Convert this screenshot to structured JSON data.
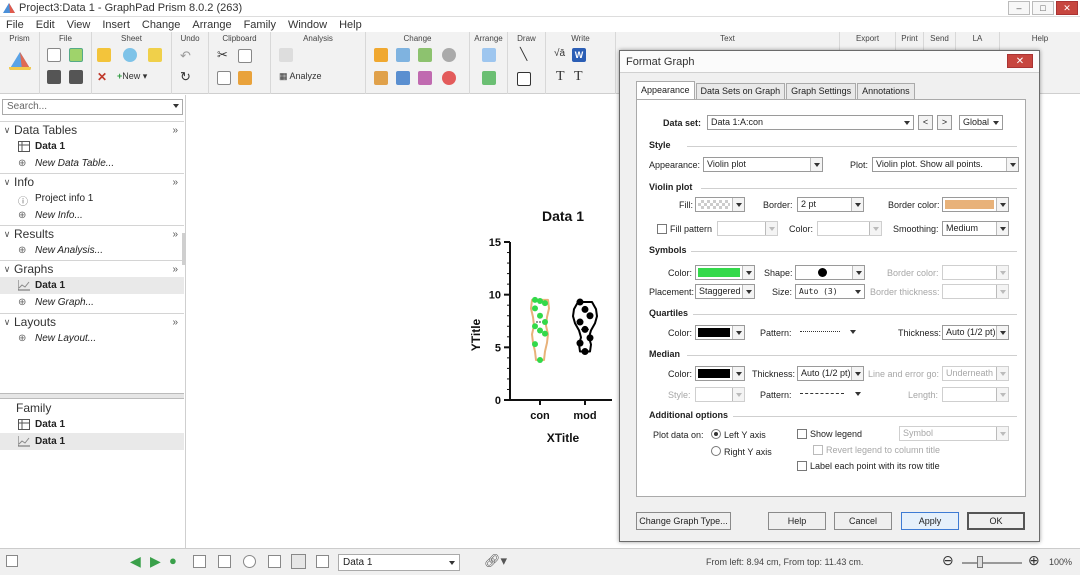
{
  "window": {
    "title": "Project3:Data 1 - GraphPad Prism 8.0.2 (263)"
  },
  "menu": [
    "File",
    "Edit",
    "View",
    "Insert",
    "Change",
    "Arrange",
    "Family",
    "Window",
    "Help"
  ],
  "ribbon": {
    "groups": [
      "Prism",
      "File",
      "Sheet",
      "Undo",
      "Clipboard",
      "Analysis",
      "Change",
      "Arrange",
      "Draw",
      "Write",
      "Text",
      "Export",
      "Print",
      "Send",
      "LA",
      "Help"
    ],
    "new_label": "New",
    "analyze_label": "Analyze"
  },
  "nav": {
    "search_placeholder": "Search...",
    "sections": [
      {
        "title": "Data Tables",
        "items": [
          {
            "label": "Data 1"
          },
          {
            "label": "New Data Table..."
          }
        ]
      },
      {
        "title": "Info",
        "items": [
          {
            "label": "Project info 1"
          },
          {
            "label": "New Info..."
          }
        ]
      },
      {
        "title": "Results",
        "items": [
          {
            "label": "New Analysis..."
          }
        ]
      },
      {
        "title": "Graphs",
        "items": [
          {
            "label": "Data 1"
          },
          {
            "label": "New Graph..."
          }
        ]
      },
      {
        "title": "Layouts",
        "items": [
          {
            "label": "New Layout..."
          }
        ]
      }
    ],
    "family": {
      "title": "Family",
      "items": [
        {
          "label": "Data 1"
        },
        {
          "label": "Data 1"
        }
      ]
    }
  },
  "graph": {
    "title": "Data 1",
    "ylabel": "YTitle",
    "xlabel": "XTitle",
    "yticks": [
      "0",
      "5",
      "10",
      "15"
    ],
    "categories": [
      "con",
      "mod"
    ]
  },
  "chart_data": {
    "type": "violin",
    "title": "Data 1",
    "xlabel": "XTitle",
    "ylabel": "YTitle",
    "ylim": [
      0,
      15
    ],
    "categories": [
      "con",
      "mod"
    ],
    "series": [
      {
        "name": "con",
        "values": [
          9.5,
          9.4,
          9.2,
          8.7,
          8.0,
          7.4,
          7.0,
          6.6,
          6.3,
          5.3,
          3.8
        ]
      },
      {
        "name": "mod",
        "values": [
          9.3,
          8.6,
          8.0,
          7.4,
          6.7,
          5.9,
          5.4,
          4.6
        ]
      }
    ]
  },
  "status": {
    "sheet": "Data 1",
    "position": "From left: 8.94 cm, From top: 11.43 cm.",
    "zoom": "100%"
  },
  "dialog": {
    "title": "Format Graph",
    "tabs": [
      "Appearance",
      "Data Sets on Graph",
      "Graph Settings",
      "Annotations"
    ],
    "dataset_label": "Data set:",
    "dataset_value": "Data 1:A:con",
    "scope": "Global",
    "sections": {
      "style": "Style",
      "violin": "Violin plot",
      "symbols": "Symbols",
      "quartiles": "Quartiles",
      "median": "Median",
      "additional": "Additional options"
    },
    "style": {
      "appearance_label": "Appearance:",
      "appearance_value": "Violin plot",
      "plot_label": "Plot:",
      "plot_value": "Violin plot. Show all points."
    },
    "violin": {
      "fill_label": "Fill:",
      "border_label": "Border:",
      "border_value": "2 pt",
      "border_color_label": "Border color:",
      "fill_pattern_label": "Fill pattern",
      "color_label": "Color:",
      "smoothing_label": "Smoothing:",
      "smoothing_value": "Medium"
    },
    "symbols": {
      "color_label": "Color:",
      "shape_label": "Shape:",
      "border_color_label": "Border color:",
      "placement_label": "Placement:",
      "placement_value": "Staggered",
      "size_label": "Size:",
      "size_value": "Auto (3)",
      "border_thickness_label": "Border thickness:"
    },
    "quartiles": {
      "color_label": "Color:",
      "pattern_label": "Pattern:",
      "thickness_label": "Thickness:",
      "thickness_value": "Auto (1/2 pt)"
    },
    "median": {
      "color_label": "Color:",
      "thickness_label": "Thickness:",
      "thickness_value": "Auto (1/2 pt)",
      "line_error_label": "Line and error go:",
      "line_error_value": "Underneath",
      "style_label": "Style:",
      "pattern_label": "Pattern:",
      "length_label": "Length:"
    },
    "additional": {
      "plot_on_label": "Plot data on:",
      "left_y": "Left Y axis",
      "right_y": "Right  Y axis",
      "show_legend": "Show legend",
      "legend_value": "Symbol",
      "revert_legend": "Revert legend to column title",
      "label_each_point": "Label each point with its row title"
    },
    "buttons": {
      "change_type": "Change Graph Type...",
      "help": "Help",
      "cancel": "Cancel",
      "apply": "Apply",
      "ok": "OK"
    },
    "colors": {
      "violin_border": "#e8b27a",
      "symbol_color": "#33d94a",
      "quartile_color": "#000000",
      "median_color": "#000000"
    }
  }
}
